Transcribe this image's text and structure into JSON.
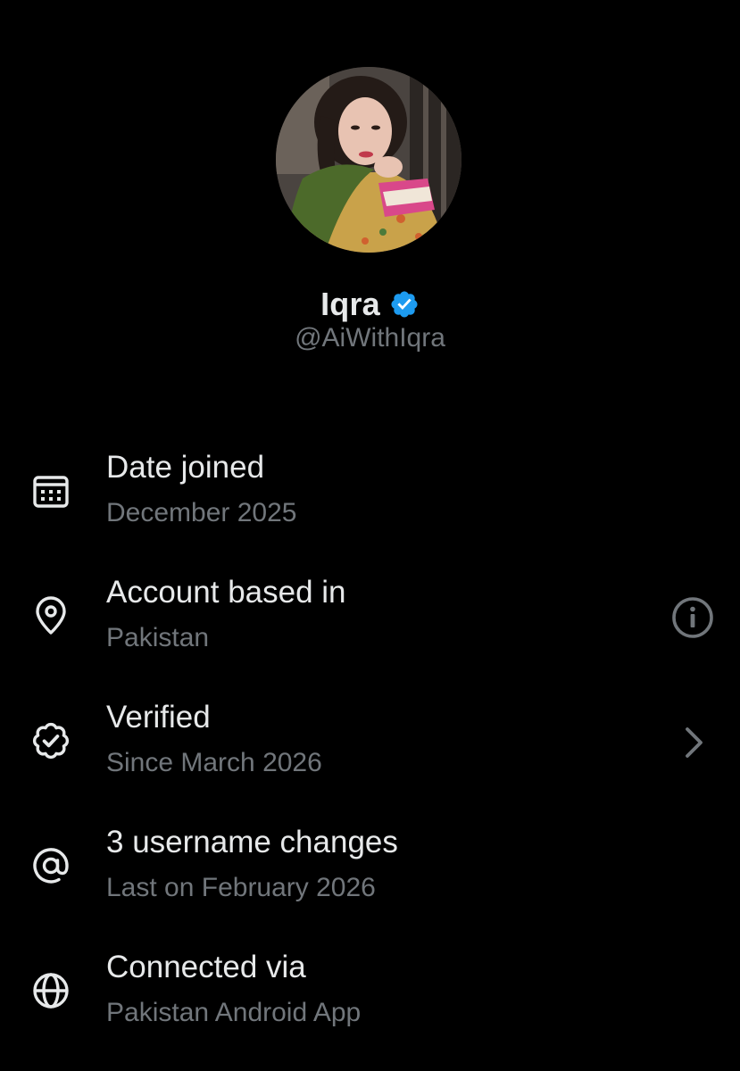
{
  "profile": {
    "name": "Iqra",
    "handle": "@AiWithIqra",
    "verified_color": "#1d9bf0"
  },
  "info_items": [
    {
      "icon": "calendar-icon",
      "title": "Date joined",
      "subtitle": "December 2025"
    },
    {
      "icon": "location-pin-icon",
      "title": "Account based in",
      "subtitle": "Pakistan",
      "trailing_icon": "info-icon"
    },
    {
      "icon": "verified-check-icon",
      "title": "Verified",
      "subtitle": "Since March 2026",
      "trailing_icon": "chevron-right-icon"
    },
    {
      "icon": "at-sign-icon",
      "title": "3 username changes",
      "subtitle": "Last on February 2026"
    },
    {
      "icon": "globe-icon",
      "title": "Connected via",
      "subtitle": "Pakistan Android App"
    }
  ],
  "colors": {
    "background": "#000000",
    "primary_text": "#e7e9ea",
    "secondary_text": "#71767b",
    "accent": "#1d9bf0"
  }
}
